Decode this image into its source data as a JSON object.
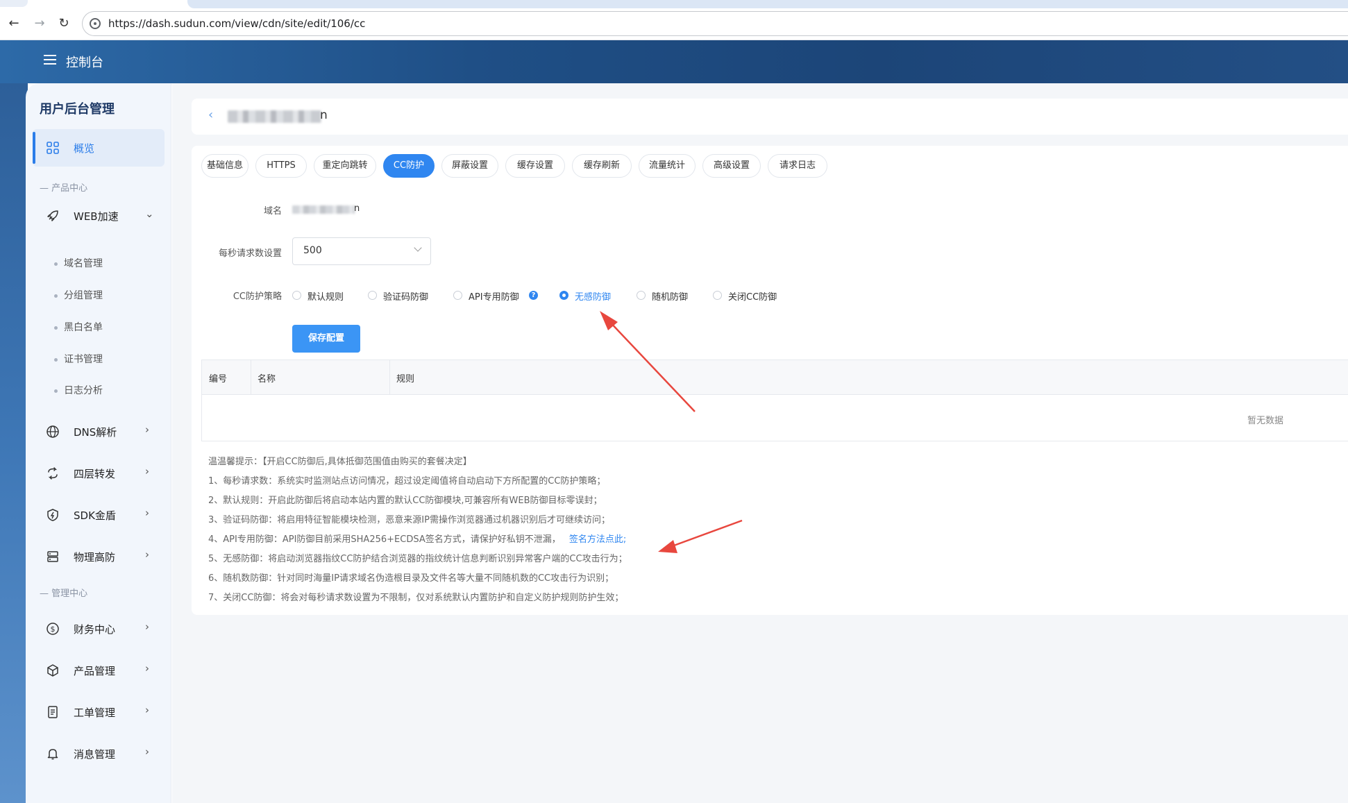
{
  "browser": {
    "url": "https://dash.sudun.com/view/cdn/site/edit/106/cc",
    "back_icon": "arrow-left",
    "forward_icon": "arrow-right",
    "reload_icon": "reload"
  },
  "header": {
    "title": "控制台",
    "menu_icon": "hamburger"
  },
  "sidebar": {
    "title": "用户后台管理",
    "overview": "概览",
    "section_product": "产品中心",
    "web_accel": "WEB加速",
    "sub_items": [
      "域名管理",
      "分组管理",
      "黑白名单",
      "证书管理",
      "日志分析"
    ],
    "items_product": [
      "DNS解析",
      "四层转发",
      "SDK金盾",
      "物理高防"
    ],
    "section_manage": "管理中心",
    "items_manage": [
      "财务中心",
      "产品管理",
      "工单管理",
      "消息管理"
    ]
  },
  "page": {
    "domain_tail": "n",
    "tabs": [
      "基础信息",
      "HTTPS",
      "重定向跳转",
      "CC防护",
      "屏蔽设置",
      "缓存设置",
      "缓存刷新",
      "流量统计",
      "高级设置",
      "请求日志"
    ],
    "active_tab": "CC防护",
    "form": {
      "domain_label": "域名",
      "domain_tail": "n",
      "rps_label": "每秒请求数设置",
      "rps_value": "500",
      "strategy_label": "CC防护策略",
      "strategies": [
        "默认规则",
        "验证码防御",
        "API专用防御",
        "无感防御",
        "随机防御",
        "关闭CC防御"
      ],
      "selected_strategy": "无感防御",
      "save_label": "保存配置"
    },
    "table": {
      "columns": [
        "编号",
        "名称",
        "规则"
      ],
      "empty_text": "暂无数据"
    },
    "tips": {
      "title": "温温馨提示：【开启CC防御后,具体抵御范围值由购买的套餐决定】",
      "lines": [
        "1、每秒请求数：系统实时监测站点访问情况，超过设定阈值将自动启动下方所配置的CC防护策略；",
        "2、默认规则：开启此防御后将启动本站内置的默认CC防御模块,可兼容所有WEB防御目标零误封；",
        "3、验证码防御：将启用特征智能模块检测，恶意来源IP需操作浏览器通过机器识别后才可继续访问；",
        "4、API专用防御：API防御目前采用SHA256+ECDSA签名方式，请保护好私钥不泄漏，",
        "5、无感防御：将启动浏览器指纹CC防护结合浏览器的指纹统计信息判断识别异常客户端的CC攻击行为；",
        "6、随机数防御：针对同时海量IP请求域名伪造根目录及文件名等大量不同随机数的CC攻击行为识别；",
        "7、关闭CC防御：将会对每秒请求数设置为不限制，仅对系统默认内置防护和自定义防护规则防护生效；"
      ],
      "link": "签名方法点此",
      "link_suffix": ";"
    }
  },
  "colors": {
    "accent": "#2f86f0",
    "header_bg": "#1f4f86",
    "arrow": "#e8473e"
  }
}
